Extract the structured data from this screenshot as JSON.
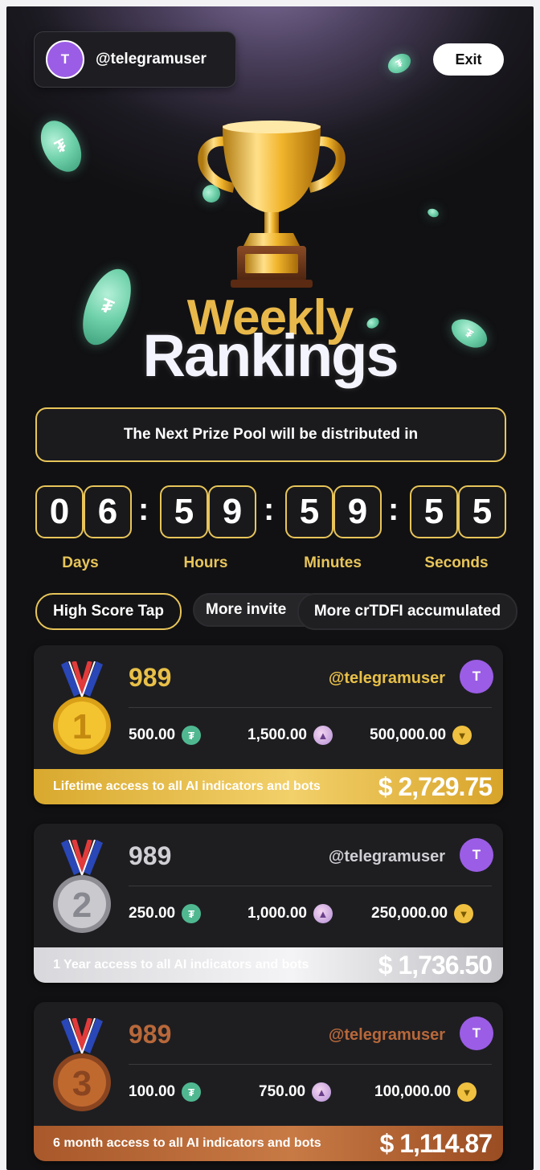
{
  "header": {
    "avatar_initial": "T",
    "username": "@telegramuser",
    "exit_label": "Exit"
  },
  "title": {
    "line1": "Weekly",
    "line2": "Rankings"
  },
  "prize_notice": "The Next Prize Pool will be distributed in",
  "countdown": {
    "digits": [
      "0",
      "6",
      "5",
      "9",
      "5",
      "9",
      "5",
      "5"
    ],
    "separator": ":",
    "labels": [
      "Days",
      "Hours",
      "Minutes",
      "Seconds"
    ]
  },
  "tabs": [
    {
      "label": "High Score Tap",
      "active": true
    },
    {
      "label": "More invite",
      "active": false
    },
    {
      "label": "More crTDFI accumulated",
      "active": false
    }
  ],
  "rankings": [
    {
      "rank": "1",
      "score": "989",
      "handle": "@telegramuser",
      "avatar_initial": "T",
      "usdt": "500.00",
      "crystal": "1,500.00",
      "token": "500,000.00",
      "reward_text": "Lifetime access to all AI indicators and bots",
      "reward_amount": "$ 2,729.75",
      "accent": "#e8c048"
    },
    {
      "rank": "2",
      "score": "989",
      "handle": "@telegramuser",
      "avatar_initial": "T",
      "usdt": "250.00",
      "crystal": "1,000.00",
      "token": "250,000.00",
      "reward_text": "1 Year  access to all AI indicators and bots",
      "reward_amount": "$ 1,736.50",
      "accent": "#c8c8cc"
    },
    {
      "rank": "3",
      "score": "989",
      "handle": "@telegramuser",
      "avatar_initial": "T",
      "usdt": "100.00",
      "crystal": "750.00",
      "token": "100,000.00",
      "reward_text": "6 month  access to all AI indicators and bots",
      "reward_amount": "$ 1,114.87",
      "accent": "#b8683a"
    }
  ],
  "colors": {
    "gold": "#e8c55a",
    "silver": "#c8c8cc",
    "bronze": "#b8683a",
    "avatar": "#9b5de5"
  }
}
